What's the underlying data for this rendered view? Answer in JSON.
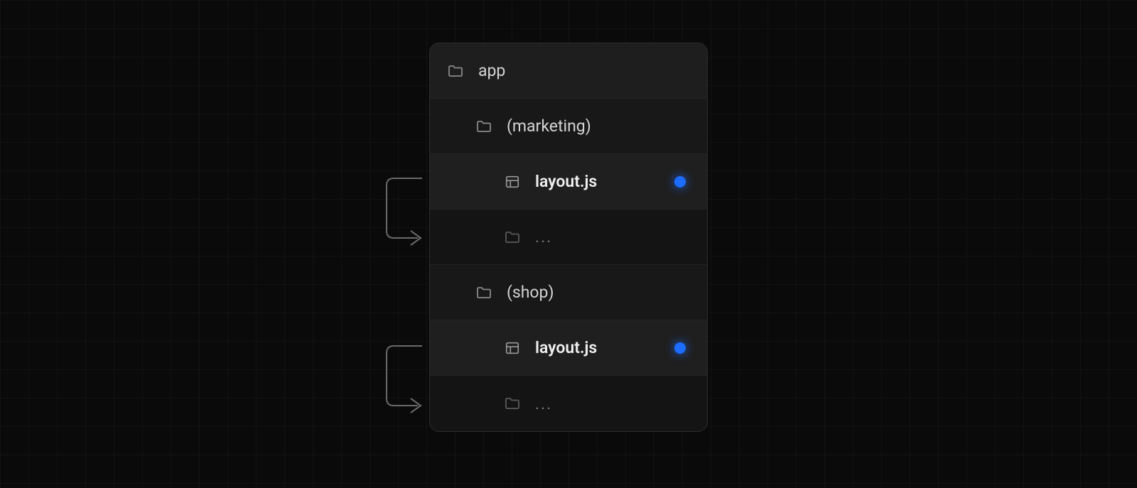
{
  "tree": {
    "root": "app",
    "groups": [
      {
        "name": "(marketing)",
        "file": "layout.js",
        "more": "..."
      },
      {
        "name": "(shop)",
        "file": "layout.js",
        "more": "..."
      }
    ]
  },
  "colors": {
    "dot": "#1c6dff"
  }
}
